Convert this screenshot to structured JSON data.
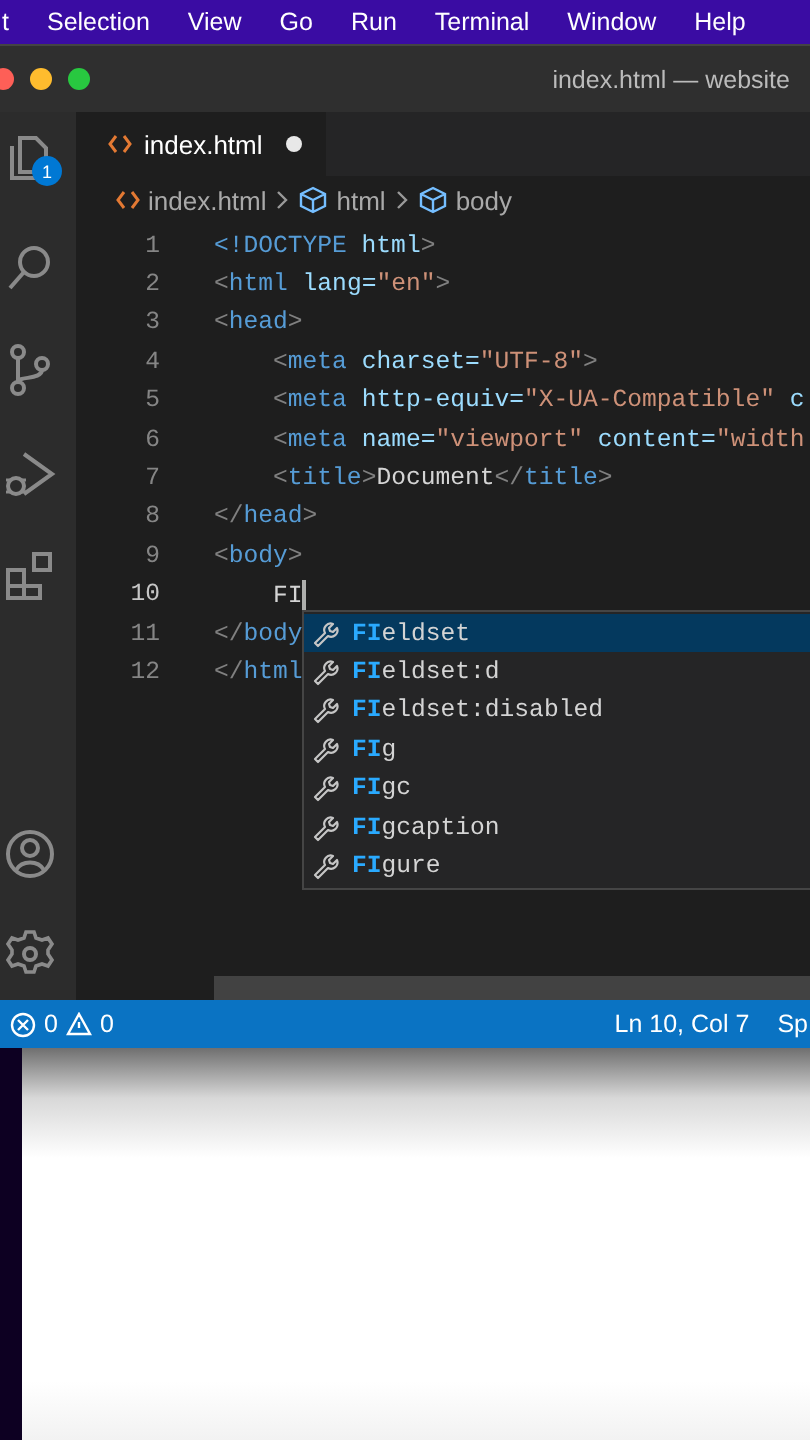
{
  "menu_bar": [
    "t",
    "Selection",
    "View",
    "Go",
    "Run",
    "Terminal",
    "Window",
    "Help"
  ],
  "window": {
    "title": "index.html — website"
  },
  "activity_bar": {
    "explorer_badge": "1"
  },
  "tabs": [
    {
      "label": "index.html",
      "selected": true,
      "modified": true
    }
  ],
  "breadcrumb": [
    {
      "label": "index.html",
      "kind": "file"
    },
    {
      "label": "html",
      "kind": "element"
    },
    {
      "label": "body",
      "kind": "element"
    }
  ],
  "code_lines": [
    {
      "number": "1",
      "current": false,
      "tokens": [
        {
          "text": "<!DOCTYPE",
          "kind": "tag"
        },
        {
          "text": " html",
          "kind": "attr"
        },
        {
          "text": ">",
          "kind": "punct"
        }
      ]
    },
    {
      "number": "2",
      "current": false,
      "tokens": [
        {
          "text": "<",
          "kind": "punct"
        },
        {
          "text": "html",
          "kind": "tag"
        },
        {
          "text": " lang=",
          "kind": "attr"
        },
        {
          "text": "\"en\"",
          "kind": "string"
        },
        {
          "text": ">",
          "kind": "punct"
        }
      ]
    },
    {
      "number": "3",
      "current": false,
      "tokens": [
        {
          "text": "<",
          "kind": "punct"
        },
        {
          "text": "head",
          "kind": "tag"
        },
        {
          "text": ">",
          "kind": "punct"
        }
      ]
    },
    {
      "number": "4",
      "current": false,
      "tokens": [
        {
          "text": "    <",
          "kind": "punct"
        },
        {
          "text": "meta",
          "kind": "tag"
        },
        {
          "text": " charset=",
          "kind": "attr"
        },
        {
          "text": "\"UTF-8\"",
          "kind": "string"
        },
        {
          "text": ">",
          "kind": "punct"
        }
      ]
    },
    {
      "number": "5",
      "current": false,
      "tokens": [
        {
          "text": "    <",
          "kind": "punct"
        },
        {
          "text": "meta",
          "kind": "tag"
        },
        {
          "text": " http-equiv=",
          "kind": "attr"
        },
        {
          "text": "\"X-UA-Compatible\"",
          "kind": "string"
        },
        {
          "text": " c",
          "kind": "attr"
        }
      ]
    },
    {
      "number": "6",
      "current": false,
      "tokens": [
        {
          "text": "    <",
          "kind": "punct"
        },
        {
          "text": "meta",
          "kind": "tag"
        },
        {
          "text": " name=",
          "kind": "attr"
        },
        {
          "text": "\"viewport\"",
          "kind": "string"
        },
        {
          "text": " content=",
          "kind": "attr"
        },
        {
          "text": "\"width",
          "kind": "string"
        }
      ]
    },
    {
      "number": "7",
      "current": false,
      "tokens": [
        {
          "text": "    <",
          "kind": "punct"
        },
        {
          "text": "title",
          "kind": "tag"
        },
        {
          "text": ">",
          "kind": "punct"
        },
        {
          "text": "Document",
          "kind": "text"
        },
        {
          "text": "</",
          "kind": "punct"
        },
        {
          "text": "title",
          "kind": "tag"
        },
        {
          "text": ">",
          "kind": "punct"
        }
      ]
    },
    {
      "number": "8",
      "current": false,
      "tokens": [
        {
          "text": "</",
          "kind": "punct"
        },
        {
          "text": "head",
          "kind": "tag"
        },
        {
          "text": ">",
          "kind": "punct"
        }
      ]
    },
    {
      "number": "9",
      "current": false,
      "tokens": [
        {
          "text": "<",
          "kind": "punct"
        },
        {
          "text": "body",
          "kind": "tag"
        },
        {
          "text": ">",
          "kind": "punct"
        }
      ]
    },
    {
      "number": "10",
      "current": true,
      "tokens": [
        {
          "text": "    FI",
          "kind": "text"
        }
      ]
    },
    {
      "number": "11",
      "current": false,
      "tokens": [
        {
          "text": "</",
          "kind": "punct"
        },
        {
          "text": "body",
          "kind": "tag"
        }
      ]
    },
    {
      "number": "12",
      "current": false,
      "tokens": [
        {
          "text": "</",
          "kind": "punct"
        },
        {
          "text": "html",
          "kind": "tag"
        }
      ]
    }
  ],
  "suggestions": [
    {
      "match": "FI",
      "rest": "eldset",
      "selected": true
    },
    {
      "match": "FI",
      "rest": "eldset:d",
      "selected": false
    },
    {
      "match": "FI",
      "rest": "eldset:disabled",
      "selected": false
    },
    {
      "match": "FI",
      "rest": "g",
      "selected": false
    },
    {
      "match": "FI",
      "rest": "gc",
      "selected": false
    },
    {
      "match": "FI",
      "rest": "gcaption",
      "selected": false
    },
    {
      "match": "FI",
      "rest": "gure",
      "selected": false
    }
  ],
  "status_bar": {
    "errors": "0",
    "warnings": "0",
    "position": "Ln 10, Col 7",
    "item_cut": "Sp"
  }
}
